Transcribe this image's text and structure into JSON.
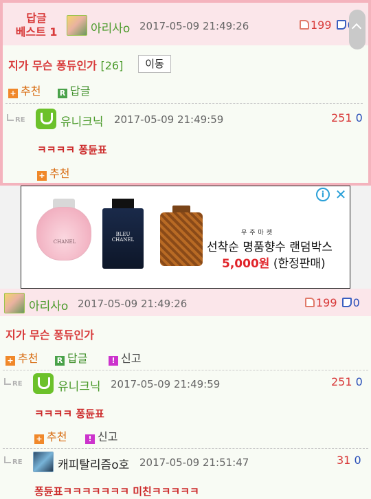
{
  "best": {
    "badge_line1": "답글",
    "badge_line2": "베스트 1",
    "username": "아리사o",
    "timestamp": "2017-05-09 21:49:26",
    "upvotes": "199",
    "downvotes": "0",
    "title": "지가 무슨 퐁듀인가",
    "count": "[26]",
    "move_label": "이동",
    "recommend_label": "추천",
    "reply_label": "답글",
    "reply": {
      "re": "RE",
      "username": "유니크닉",
      "timestamp": "2017-05-09 21:49:59",
      "upvotes": "251",
      "downvotes": "0",
      "body": "ㅋㅋㅋㅋ 퐁듄표",
      "recommend_label": "추천"
    }
  },
  "ad": {
    "brand": "우주마켓",
    "line1": "선착순 명품향수 랜덤박스",
    "price": "5,000원",
    "line2_suffix": " (한정판매)",
    "bottle1_label": "CHANEL",
    "bottle2_label": "BLEU CHANEL",
    "info_icon": "i",
    "close_icon": "✕"
  },
  "comment": {
    "username": "아리사o",
    "timestamp": "2017-05-09 21:49:26",
    "upvotes": "199",
    "downvotes": "0",
    "title": "지가 무슨 퐁듀인가",
    "recommend_label": "추천",
    "reply_label": "답글",
    "report_label": "신고"
  },
  "replies": [
    {
      "re": "RE",
      "username": "유니크닉",
      "timestamp": "2017-05-09 21:49:59",
      "upvotes": "251",
      "downvotes": "0",
      "body": "ㅋㅋㅋㅋ 퐁듄표",
      "recommend_label": "추천",
      "report_label": "신고"
    },
    {
      "re": "RE",
      "username": "캐피탈리즘o호",
      "timestamp": "2017-05-09 21:51:47",
      "upvotes": "31",
      "downvotes": "0",
      "body": "퐁듄표ㅋㅋㅋㅋㅋㅋㅋ 미친ㅋㅋㅋㅋㅋ"
    }
  ],
  "colors": {
    "accent_red": "#d83a3a",
    "accent_green": "#4a9a2a",
    "down_blue": "#2a4fb8",
    "best_border": "#f4b3bd"
  }
}
